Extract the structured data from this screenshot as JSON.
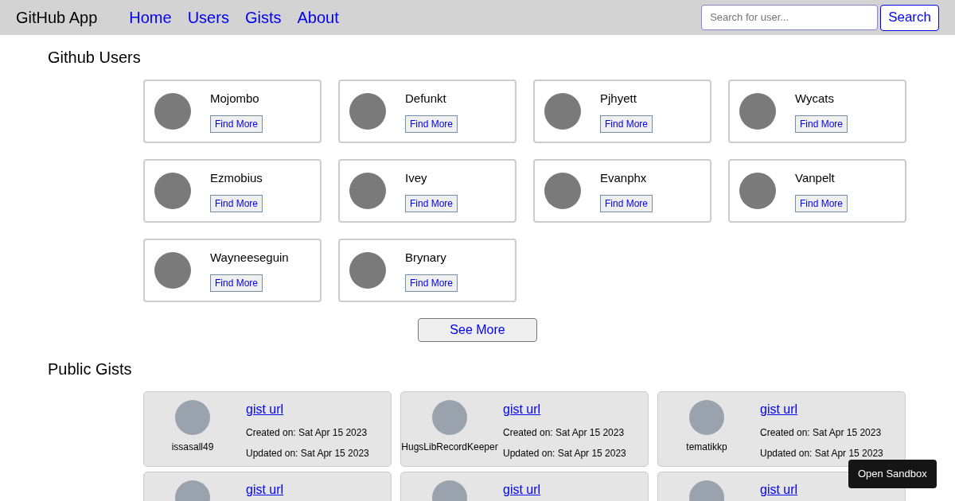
{
  "navbar": {
    "brand": "GitHub App",
    "links": [
      "Home",
      "Users",
      "Gists",
      "About"
    ],
    "search": {
      "placeholder": "Search for user..."
    },
    "search_button": "Search"
  },
  "users_section": {
    "title": "Github Users",
    "users": [
      {
        "name": "Mojombo",
        "button": "Find More"
      },
      {
        "name": "Defunkt",
        "button": "Find More"
      },
      {
        "name": "Pjhyett",
        "button": "Find More"
      },
      {
        "name": "Wycats",
        "button": "Find More"
      },
      {
        "name": "Ezmobius",
        "button": "Find More"
      },
      {
        "name": "Ivey",
        "button": "Find More"
      },
      {
        "name": "Evanphx",
        "button": "Find More"
      },
      {
        "name": "Vanpelt",
        "button": "Find More"
      },
      {
        "name": "Wayneeseguin",
        "button": "Find More"
      },
      {
        "name": "Brynary",
        "button": "Find More"
      }
    ],
    "see_more": "See More"
  },
  "gists_section": {
    "title": "Public Gists",
    "gists": [
      {
        "user": "issasall49",
        "link": "gist url",
        "created": "Created on: Sat Apr 15 2023",
        "updated": "Updated on: Sat Apr 15 2023"
      },
      {
        "user": "HugsLibRecordKeeper",
        "link": "gist url",
        "created": "Created on: Sat Apr 15 2023",
        "updated": "Updated on: Sat Apr 15 2023"
      },
      {
        "user": "tematikkp",
        "link": "gist url",
        "created": "Created on: Sat Apr 15 2023",
        "updated": "Updated on: Sat Apr 15 2023"
      },
      {
        "link": "gist url"
      },
      {
        "link": "gist url"
      },
      {
        "link": "gist url"
      }
    ]
  },
  "sandbox_button": "Open Sandbox"
}
